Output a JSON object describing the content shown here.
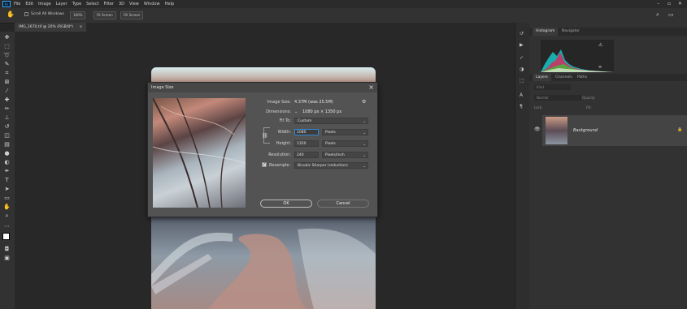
{
  "menu": {
    "items": [
      "File",
      "Edit",
      "Image",
      "Layer",
      "Type",
      "Select",
      "Filter",
      "3D",
      "View",
      "Window",
      "Help"
    ]
  },
  "options": {
    "scroll_all": "Scroll All Windows",
    "zoom": "100%",
    "fit_screen": "Fit Screen",
    "fill_screen": "Fill Screen"
  },
  "document": {
    "tab_title": "IMG_1670.tif @ 20% (RGB/8*)"
  },
  "panels": {
    "histogram_tab": "Histogram",
    "navigator_tab": "Navigator",
    "layers_tab": "Layers",
    "channels_tab": "Channels",
    "paths_tab": "Paths",
    "kind_placeholder": "Kind",
    "blend_mode": "Normal",
    "opacity_label": "Opacity:",
    "lock_label": "Lock:",
    "fill_label": "Fill:",
    "layer_name": "Background"
  },
  "dialog": {
    "title": "Image Size",
    "image_size_label": "Image Size:",
    "image_size_value": "4.37M (was 25.5M)",
    "dimensions_label": "Dimensions:",
    "dimensions_value": "1080 px  ×  1350 px",
    "fit_to_label": "Fit To:",
    "fit_to_value": "Custom",
    "width_label": "Width:",
    "width_value": "1080",
    "width_unit": "Pixels",
    "height_label": "Height:",
    "height_value": "1350",
    "height_unit": "Pixels",
    "resolution_label": "Resolution:",
    "resolution_value": "240",
    "resolution_unit": "Pixels/Inch",
    "resample_label": "Resample:",
    "resample_value": "Bicubic Sharper (reduction)",
    "ok": "OK",
    "cancel": "Cancel"
  }
}
